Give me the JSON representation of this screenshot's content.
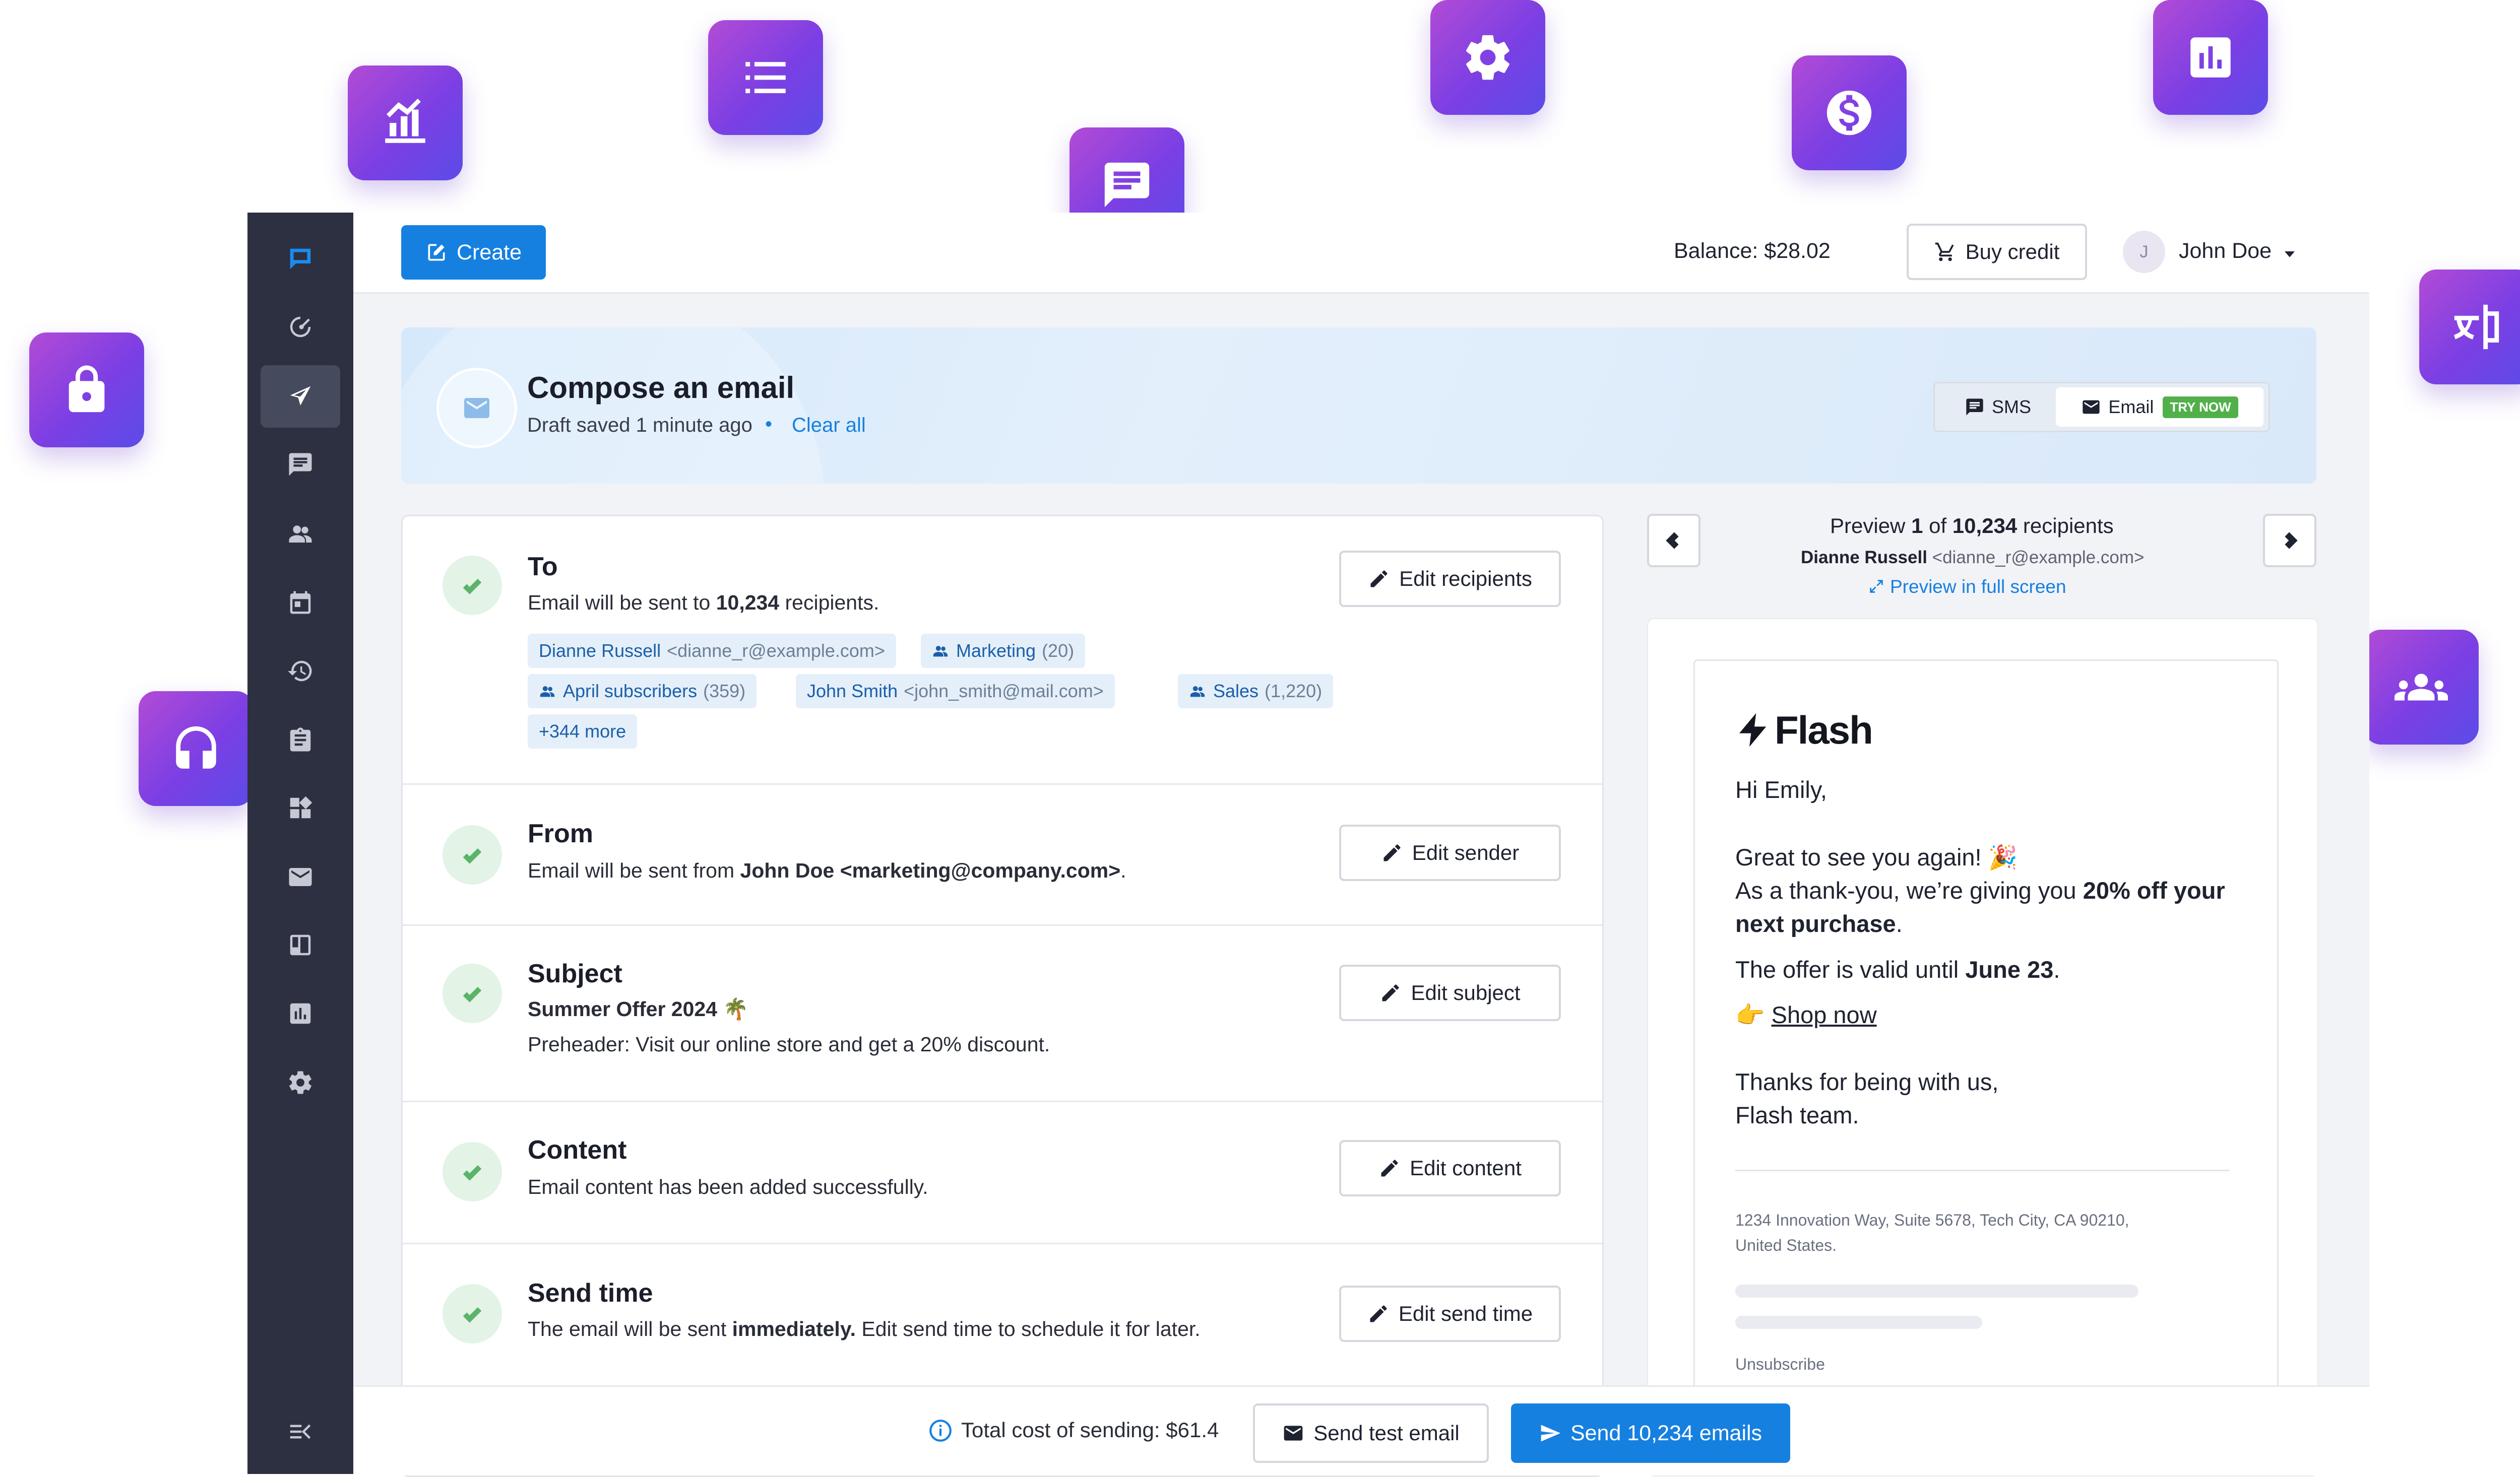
{
  "floating_icons": [
    {
      "name": "chart-growth-icon"
    },
    {
      "name": "list-icon"
    },
    {
      "name": "chat-icon"
    },
    {
      "name": "gear-icon"
    },
    {
      "name": "dollar-icon"
    },
    {
      "name": "bar-chart-icon"
    },
    {
      "name": "lock-icon"
    },
    {
      "name": "translate-icon"
    },
    {
      "name": "headset-icon"
    },
    {
      "name": "group-icon"
    }
  ],
  "sidebar": {
    "items": [
      "logo-icon",
      "dashboard-icon",
      "send-icon",
      "chat-icon",
      "contacts-icon",
      "calendar-icon",
      "history-icon",
      "clipboard-icon",
      "widgets-icon",
      "mail-icon",
      "layout-icon",
      "analytics-icon",
      "settings-icon"
    ],
    "collapse_icon": "collapse-icon",
    "active_index": 2
  },
  "topbar": {
    "create_label": "Create",
    "balance": "Balance: $28.02",
    "buy_credit_label": "Buy credit",
    "user_initial": "J",
    "user_name": "John Doe"
  },
  "banner": {
    "title": "Compose an email",
    "draft_status": "Draft saved 1 minute ago",
    "separator": "•",
    "clear_all": "Clear all",
    "tab_sms": "SMS",
    "tab_email": "Email",
    "try_now": "TRY NOW"
  },
  "sections": {
    "to": {
      "title": "To",
      "text_prefix": "Email will be sent to ",
      "text_count": "10,234",
      "text_suffix": " recipients.",
      "button": "Edit recipients",
      "chips": [
        {
          "label": "Dianne Russell",
          "extra": "<dianne_r@example.com>",
          "group": false
        },
        {
          "label": "Marketing",
          "extra": "(20)",
          "group": true
        },
        {
          "label": "April subscribers",
          "extra": "(359)",
          "group": true
        },
        {
          "label": "John Smith",
          "extra": "<john_smith@mail.com>",
          "group": false
        },
        {
          "label": "Sales",
          "extra": "(1,220)",
          "group": true
        },
        {
          "label": "+344 more",
          "extra": "",
          "group": false
        }
      ]
    },
    "from": {
      "title": "From",
      "text_prefix": "Email will be sent from ",
      "text_bold": "John Doe <marketing@company.com>",
      "text_suffix": ".",
      "button": "Edit sender"
    },
    "subject": {
      "title": "Subject",
      "subject_line": "Summer Offer 2024 🌴",
      "preheader": "Preheader: Visit our online store and get a 20% discount.",
      "button": "Edit subject"
    },
    "content": {
      "title": "Content",
      "text": "Email content has been added successfully.",
      "button": "Edit content"
    },
    "send_time": {
      "title": "Send time",
      "text_prefix": "The email will be sent ",
      "text_bold": "immediately.",
      "text_suffix": " Edit send time to schedule it for later.",
      "button": "Edit send time"
    }
  },
  "preview": {
    "label_prefix": "Preview ",
    "index": "1",
    "label_mid": " of ",
    "total": "10,234",
    "label_suffix": " recipients",
    "recipient_name": "Dianne Russell",
    "recipient_email": "<dianne_r@example.com>",
    "full_screen": "Preview in full screen"
  },
  "email": {
    "brand": "Flash",
    "greeting": "Hi Emily,",
    "line1": "Great to see you again! 🎉",
    "line2_prefix": "As a thank-you, we’re giving you ",
    "line2_bold": "20% off your",
    "line3_bold": "next purchase",
    "line3_suffix": ".",
    "offer_prefix": "The offer is valid until ",
    "offer_bold": "June 23",
    "offer_suffix": ".",
    "shop_emoji": "👉",
    "shop_link": "Shop now",
    "thanks1": "Thanks for being with us,",
    "thanks2": "Flash team.",
    "address1": "1234 Innovation Way, Suite 5678, Tech City, CA 90210,",
    "address2": "United States.",
    "unsubscribe": "Unsubscribe"
  },
  "footer": {
    "total_cost": "Total cost of sending: $61.4",
    "send_test": "Send test email",
    "send_all": "Send 10,234 emails"
  },
  "colors": {
    "primary": "#1680e0",
    "sidebar": "#2d3041",
    "icon_gradient_start": "#b34bd6",
    "icon_gradient_end": "#5b4ce8",
    "success": "#5cb36a",
    "try_now": "#52b04a"
  }
}
